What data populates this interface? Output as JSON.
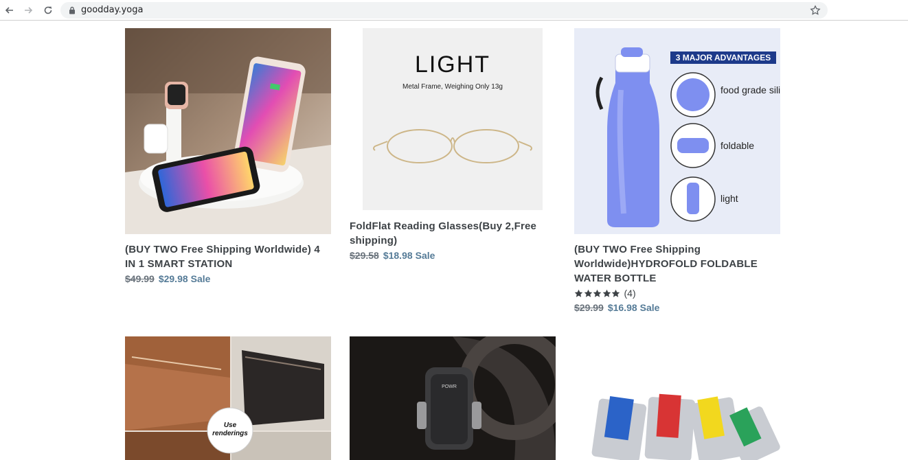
{
  "browser": {
    "url": "goodday.yoga"
  },
  "products": [
    {
      "title": "(BUY TWO Free Shipping Worldwide) 4 IN 1 SMART STATION",
      "old_price": "$49.99",
      "new_price": "$29.98",
      "sale_label": "Sale"
    },
    {
      "title": "FoldFlat Reading Glasses(Buy 2,Free shipping)",
      "old_price": "$29.58",
      "new_price": "$18.98",
      "sale_label": "Sale",
      "image_text": {
        "heading": "LIGHT",
        "sub": "Metal Frame, Weighing Only 13g"
      }
    },
    {
      "title": "(BUY TWO Free Shipping Worldwide)HYDROFOLD FOLDABLE WATER BOTTLE",
      "rating": 5,
      "review_count": "(4)",
      "old_price": "$29.99",
      "new_price": "$16.98",
      "sale_label": "Sale",
      "image_text": {
        "banner": "3 MAJOR ADVANTAGES",
        "f1": "food grade silicone",
        "f2": "foldable",
        "f3": "light"
      }
    },
    {
      "image_text": {
        "badge": "Use renderings"
      }
    },
    {
      "image_text": {
        "brand": "POWR"
      }
    },
    {}
  ],
  "colors": {
    "title": "#3d4246",
    "old_price": "#69727b",
    "sale_price": "#557b97",
    "bottle_bg": "#e8ecf7",
    "banner": "#1d3a8a"
  },
  "icons": [
    "back-arrow-icon",
    "forward-arrow-icon",
    "reload-icon",
    "lock-icon",
    "star-bookmark-icon",
    "rating-star-icon"
  ]
}
